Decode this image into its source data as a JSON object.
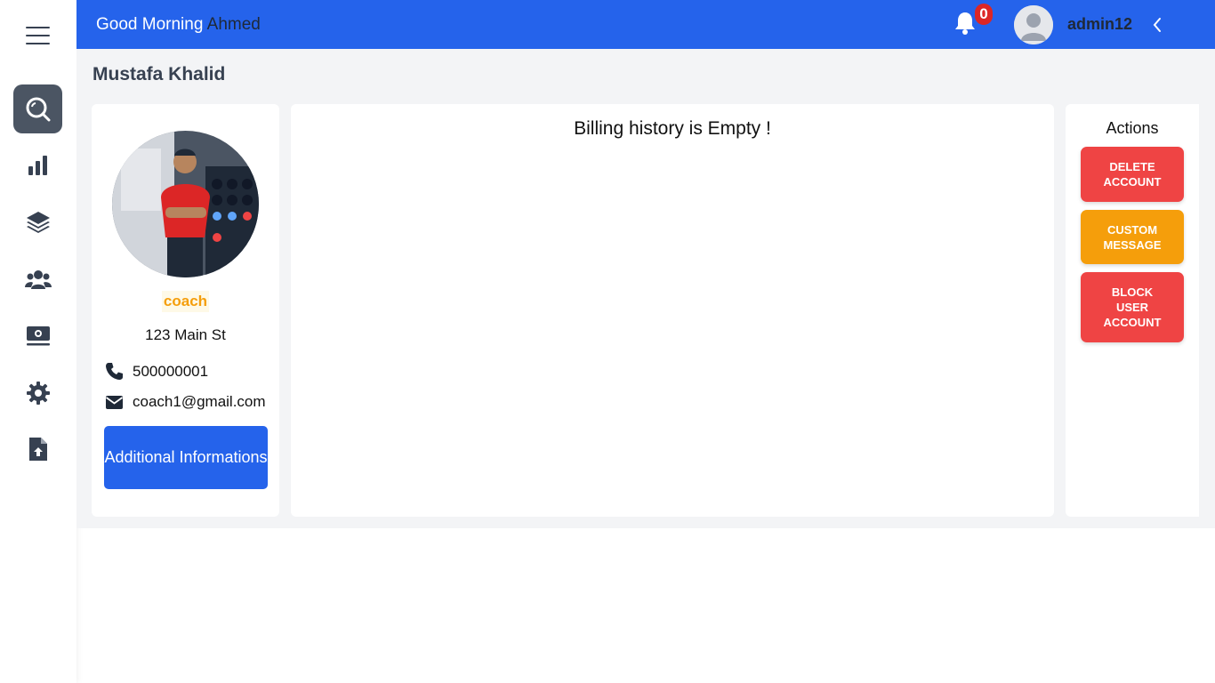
{
  "header": {
    "greeting": "Good Morning",
    "greeting_name": "Ahmed",
    "notification_count": "0",
    "username": "admin12"
  },
  "sidebar": {
    "items": [
      {
        "icon": "search-icon",
        "active": true
      },
      {
        "icon": "chart-icon",
        "active": false
      },
      {
        "icon": "layers-icon",
        "active": false
      },
      {
        "icon": "users-icon",
        "active": false
      },
      {
        "icon": "money-icon",
        "active": false
      },
      {
        "icon": "gear-icon",
        "active": false
      },
      {
        "icon": "file-upload-icon",
        "active": false
      }
    ]
  },
  "page": {
    "title": "Mustafa Khalid"
  },
  "profile": {
    "role": "coach",
    "address": "123 Main St",
    "phone": "500000001",
    "email": "coach1@gmail.com",
    "additional_button": "Additional Informations"
  },
  "billing": {
    "empty_message": "Billing history is Empty !"
  },
  "actions": {
    "title": "Actions",
    "delete_label": "DELETE ACCOUNT",
    "custom_label": "CUSTOM MESSAGE",
    "block_label": "BLOCK USER ACCOUNT"
  },
  "colors": {
    "primary": "#2563eb",
    "danger": "#ef4444",
    "warning": "#f59e0b",
    "sidebar_active": "#4b5563"
  }
}
